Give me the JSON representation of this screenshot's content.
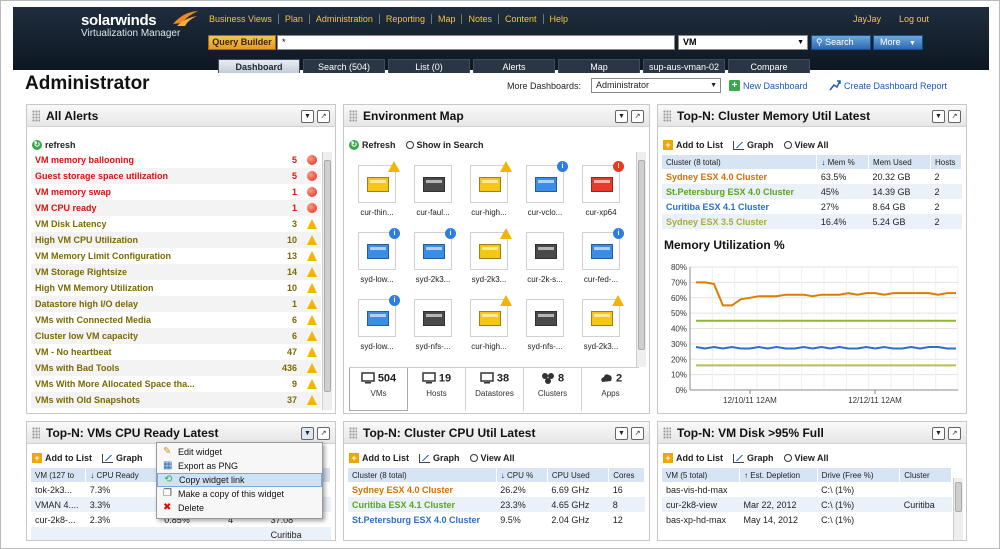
{
  "header": {
    "logo_brand": "solarwinds",
    "logo_product": "Virtualization Manager",
    "nav": [
      "Business Views",
      "Plan",
      "Administration",
      "Reporting",
      "Map",
      "Notes",
      "Content",
      "Help"
    ],
    "user": "JayJay",
    "logout": "Log out",
    "query_builder": "Query Builder",
    "query_value": "*",
    "scope_value": "VM",
    "search_label": "Search",
    "more_label": "More",
    "tabs": [
      "Dashboard",
      "Search (504)",
      "List (0)",
      "Alerts",
      "Map",
      "sup-aus-vman-02",
      "Compare"
    ],
    "active_tab": "Dashboard"
  },
  "page": {
    "title": "Administrator",
    "more_dashboards_label": "More Dashboards:",
    "dashboard_value": "Administrator",
    "new_dashboard": "New Dashboard",
    "create_report": "Create Dashboard Report"
  },
  "alerts": {
    "title": "All Alerts",
    "refresh": "refresh",
    "items": [
      {
        "name": "VM memory ballooning",
        "count": "5",
        "severity": "critical"
      },
      {
        "name": "Guest storage space utilization",
        "count": "5",
        "severity": "critical"
      },
      {
        "name": "VM memory swap",
        "count": "1",
        "severity": "critical"
      },
      {
        "name": "VM CPU ready",
        "count": "1",
        "severity": "critical"
      },
      {
        "name": "VM Disk Latency",
        "count": "3",
        "severity": "warning"
      },
      {
        "name": "High VM CPU Utilization",
        "count": "10",
        "severity": "warning"
      },
      {
        "name": "VM Memory Limit Configuration",
        "count": "13",
        "severity": "warning"
      },
      {
        "name": "VM Storage Rightsize",
        "count": "14",
        "severity": "warning"
      },
      {
        "name": "High VM Memory Utilization",
        "count": "10",
        "severity": "warning"
      },
      {
        "name": "Datastore high I/O delay",
        "count": "1",
        "severity": "warning"
      },
      {
        "name": "VMs with Connected Media",
        "count": "6",
        "severity": "warning"
      },
      {
        "name": "Cluster low VM capacity",
        "count": "6",
        "severity": "warning"
      },
      {
        "name": "VM - No heartbeat",
        "count": "47",
        "severity": "warning"
      },
      {
        "name": "VMs with Bad Tools",
        "count": "436",
        "severity": "warning"
      },
      {
        "name": "VMs With More Allocated Space tha...",
        "count": "9",
        "severity": "warning"
      },
      {
        "name": "VMs with Old Snapshots",
        "count": "37",
        "severity": "warning"
      }
    ]
  },
  "envmap": {
    "title": "Environment Map",
    "refresh": "Refresh",
    "show_in_search": "Show in Search",
    "vms": [
      {
        "label": "cur-thin...",
        "color": "#f5c518",
        "badge": "warn"
      },
      {
        "label": "cur-faul...",
        "color": "#4a4a4a",
        "badge": ""
      },
      {
        "label": "cur-high...",
        "color": "#f5c518",
        "badge": "warn"
      },
      {
        "label": "cur-vclo...",
        "color": "#3b8ee6",
        "badge": "info"
      },
      {
        "label": "cur-xp64",
        "color": "#e8392a",
        "badge": "crit"
      },
      {
        "label": "syd-low...",
        "color": "#3b8ee6",
        "badge": "info"
      },
      {
        "label": "syd-2k3...",
        "color": "#3b8ee6",
        "badge": "info"
      },
      {
        "label": "syd-2k3...",
        "color": "#f5c518",
        "badge": "warn"
      },
      {
        "label": "cur-2k-s...",
        "color": "#4a4a4a",
        "badge": ""
      },
      {
        "label": "cur-fed-...",
        "color": "#3b8ee6",
        "badge": "info"
      },
      {
        "label": "syd-low...",
        "color": "#3b8ee6",
        "badge": "info"
      },
      {
        "label": "syd-nfs-...",
        "color": "#4a4a4a",
        "badge": ""
      },
      {
        "label": "cur-high...",
        "color": "#f5c518",
        "badge": "warn"
      },
      {
        "label": "syd-nfs-...",
        "color": "#4a4a4a",
        "badge": ""
      },
      {
        "label": "syd-2k3...",
        "color": "#f5c518",
        "badge": "warn"
      }
    ],
    "summary": [
      {
        "count": "504",
        "label": "VMs"
      },
      {
        "count": "19",
        "label": "Hosts"
      },
      {
        "count": "38",
        "label": "Datastores"
      },
      {
        "count": "8",
        "label": "Clusters"
      },
      {
        "count": "2",
        "label": "Apps"
      }
    ]
  },
  "cluster_memory": {
    "title": "Top-N: Cluster Memory Util Latest",
    "add_to_list": "Add to List",
    "graph": "Graph",
    "view_all": "View All",
    "columns": [
      "Cluster (8 total)",
      "↓ Mem %",
      "Mem Used",
      "Hosts"
    ],
    "rows": [
      {
        "cluster": "Sydney ESX 4.0 Cluster",
        "mem": "63.5%",
        "used": "20.32 GB",
        "hosts": "2",
        "color": "#d66f00"
      },
      {
        "cluster": "St.Petersburg ESX 4.0 Cluster",
        "mem": "45%",
        "used": "14.39 GB",
        "hosts": "2",
        "color": "#5aa51c"
      },
      {
        "cluster": "Curitiba ESX 4.1 Cluster",
        "mem": "27%",
        "used": "8.64 GB",
        "hosts": "2",
        "color": "#2a6fc9"
      },
      {
        "cluster": "Sydney ESX 3.5 Cluster",
        "mem": "16.4%",
        "used": "5.24 GB",
        "hosts": "2",
        "color": "#a8ad3a"
      }
    ],
    "chart_title": "Memory Utilization %"
  },
  "vm_cpu": {
    "title": "Top-N: VMs CPU Ready Latest",
    "add_to_list": "Add to List",
    "graph": "Graph",
    "columns": [
      "VM (127 to",
      "↓ CPU Ready",
      "",
      "",
      ""
    ],
    "rows": [
      {
        "vm": "tok-2k3...",
        "ready": "7.3%",
        "c3": "",
        "c4": "",
        "c5": ""
      },
      {
        "vm": "VMAN 4....",
        "ready": "3.3%",
        "c3": "",
        "c4": "",
        "c5": ""
      },
      {
        "vm": "cur-2k8-...",
        "ready": "2.3%",
        "c3": "0.85%",
        "c4": "4",
        "c5": "37.08"
      },
      {
        "vm": "",
        "ready": "",
        "c3": "",
        "c4": "",
        "c5": "Curitiba"
      }
    ],
    "menu": [
      "Edit widget",
      "Export as PNG",
      "Copy widget link",
      "Make a copy of this widget",
      "Delete"
    ],
    "menu_highlight": "Copy widget link"
  },
  "cluster_cpu": {
    "title": "Top-N: Cluster CPU Util Latest",
    "add_to_list": "Add to List",
    "graph": "Graph",
    "view_all": "View All",
    "columns": [
      "Cluster (8 total)",
      "↓ CPU %",
      "CPU Used",
      "Cores"
    ],
    "rows": [
      {
        "cluster": "Sydney ESX 4.0 Cluster",
        "cpu": "26.2%",
        "used": "6.69 GHz",
        "cores": "16",
        "color": "#d66f00"
      },
      {
        "cluster": "Curitiba ESX 4.1 Cluster",
        "cpu": "23.3%",
        "used": "4.65 GHz",
        "cores": "8",
        "color": "#5aa51c"
      },
      {
        "cluster": "St.Petersburg ESX 4.0 Cluster",
        "cpu": "9.5%",
        "used": "2.04 GHz",
        "cores": "12",
        "color": "#2a6fc9"
      }
    ]
  },
  "vm_disk": {
    "title": "Top-N: VM Disk >95% Full",
    "add_to_list": "Add to List",
    "graph": "Graph",
    "view_all": "View All",
    "columns": [
      "VM (5 total)",
      "↑ Est. Depletion",
      "Drive (Free %)",
      "Cluster"
    ],
    "rows": [
      {
        "vm": "bas-vis-hd-max",
        "dep": "",
        "drive": "C:\\ (1%)",
        "cluster": ""
      },
      {
        "vm": "cur-2k8-view",
        "dep": "Mar 22, 2012",
        "drive": "C:\\ (1%)",
        "cluster": "Curitiba"
      },
      {
        "vm": "bas-xp-hd-max",
        "dep": "May 14, 2012",
        "drive": "C:\\ (1%)",
        "cluster": ""
      }
    ]
  },
  "chart_data": {
    "type": "line",
    "title": "Memory Utilization %",
    "x_ticks": [
      "12/10/11 12AM",
      "12/12/11 12AM"
    ],
    "ylim": [
      0,
      80
    ],
    "y_ticks": [
      "0%",
      "10%",
      "20%",
      "30%",
      "40%",
      "50%",
      "60%",
      "70%",
      "80%"
    ],
    "grid": true,
    "series": [
      {
        "name": "Sydney ESX 4.0 Cluster",
        "color": "#e07b00",
        "values": [
          70,
          70,
          69,
          55,
          55,
          59,
          60,
          61,
          61,
          61,
          62,
          62,
          62,
          61,
          62,
          62,
          62,
          63,
          62,
          63,
          63,
          62,
          63,
          63,
          63,
          63,
          63,
          62,
          63,
          63
        ]
      },
      {
        "name": "St.Petersburg ESX 4.0 Cluster",
        "color": "#8fb933",
        "values": [
          45,
          45,
          45,
          45,
          45,
          45,
          45,
          45,
          45,
          45,
          45,
          45,
          45,
          45,
          45,
          45,
          45,
          45,
          45,
          45,
          45,
          45,
          45,
          45,
          45,
          45,
          45,
          45,
          45,
          45
        ]
      },
      {
        "name": "Curitiba ESX 4.1 Cluster",
        "color": "#2a6fc9",
        "values": [
          28,
          27,
          28,
          27,
          28,
          27,
          27,
          28,
          27,
          28,
          27,
          27,
          28,
          27,
          28,
          27,
          28,
          27,
          27,
          28,
          27,
          28,
          27,
          27,
          28,
          27,
          28,
          28,
          27,
          27
        ]
      },
      {
        "name": "Sydney ESX 3.5 Cluster",
        "color": "#b9bd52",
        "values": [
          16,
          16,
          16,
          16,
          16,
          16,
          16,
          16,
          16,
          16,
          16,
          16,
          16,
          16,
          16,
          16,
          16,
          16,
          16,
          16,
          16,
          16,
          16,
          16,
          16,
          16,
          16,
          16,
          16,
          16
        ]
      }
    ]
  }
}
